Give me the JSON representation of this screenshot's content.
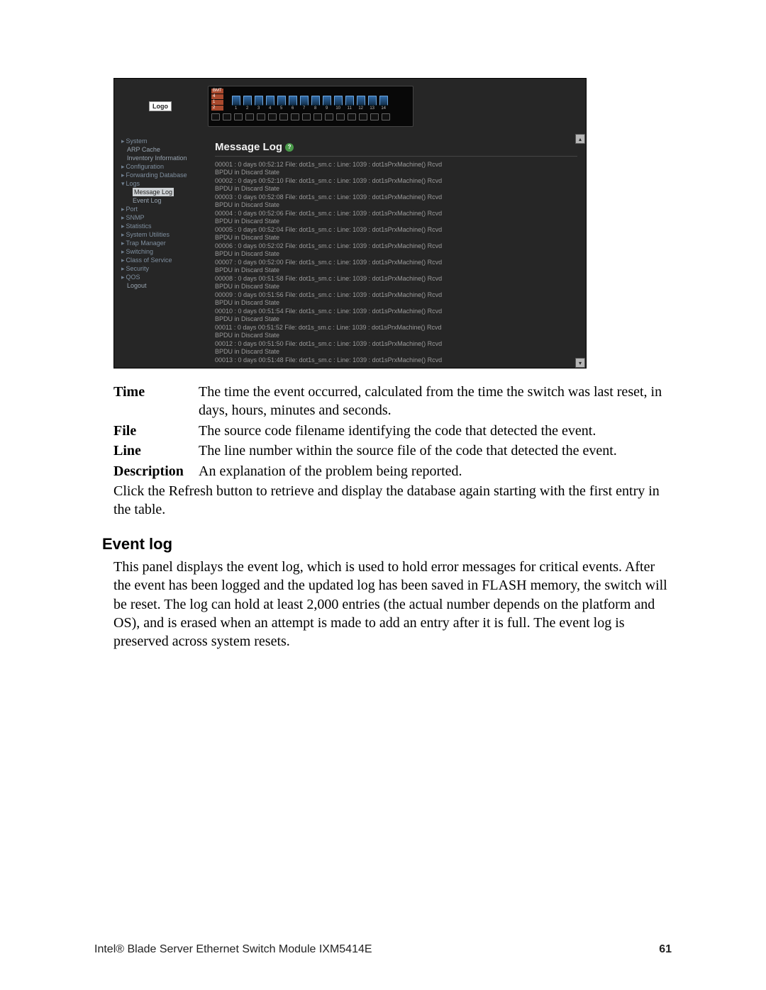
{
  "screenshot": {
    "logo_text": "Logo",
    "device_label_lines": [
      "BMT",
      "4",
      "1",
      "2"
    ],
    "port_numbers": [
      "1",
      "2",
      "3",
      "4",
      "5",
      "6",
      "7",
      "8",
      "9",
      "10",
      "11",
      "12",
      "13",
      "14"
    ],
    "nav": [
      {
        "type": "tri",
        "label": "System"
      },
      {
        "type": "sub",
        "label": "ARP Cache"
      },
      {
        "type": "sub",
        "label": "Inventory Information"
      },
      {
        "type": "tri-sub",
        "label": "Configuration"
      },
      {
        "type": "tri-sub",
        "label": "Forwarding Database"
      },
      {
        "type": "tri-open",
        "label": "Logs"
      },
      {
        "type": "sub2-selected",
        "label": "Message Log"
      },
      {
        "type": "sub2",
        "label": "Event Log"
      },
      {
        "type": "tri-sub",
        "label": "Port"
      },
      {
        "type": "tri-sub",
        "label": "SNMP"
      },
      {
        "type": "tri-sub",
        "label": "Statistics"
      },
      {
        "type": "tri-sub",
        "label": "System Utilities"
      },
      {
        "type": "tri-sub",
        "label": "Trap Manager"
      },
      {
        "type": "tri",
        "label": "Switching"
      },
      {
        "type": "tri",
        "label": "Class of Service"
      },
      {
        "type": "tri",
        "label": "Security"
      },
      {
        "type": "tri",
        "label": "QOS"
      },
      {
        "type": "sub",
        "label": "Logout"
      }
    ],
    "main_title": "Message Log",
    "help_symbol": "?",
    "log_entries": [
      {
        "l1": "00001 : 0 days 00:52:12 File: dot1s_sm.c : Line: 1039 : dot1sPrxMachine() Rcvd",
        "l2": "BPDU in Discard State"
      },
      {
        "l1": "00002 : 0 days 00:52:10 File: dot1s_sm.c : Line: 1039 : dot1sPrxMachine() Rcvd",
        "l2": "BPDU in Discard State"
      },
      {
        "l1": "00003 : 0 days 00:52:08 File: dot1s_sm.c : Line: 1039 : dot1sPrxMachine() Rcvd",
        "l2": "BPDU in Discard State"
      },
      {
        "l1": "00004 : 0 days 00:52:06 File: dot1s_sm.c : Line: 1039 : dot1sPrxMachine() Rcvd",
        "l2": "BPDU in Discard State"
      },
      {
        "l1": "00005 : 0 days 00:52:04 File: dot1s_sm.c : Line: 1039 : dot1sPrxMachine() Rcvd",
        "l2": "BPDU in Discard State"
      },
      {
        "l1": "00006 : 0 days 00:52:02 File: dot1s_sm.c : Line: 1039 : dot1sPrxMachine() Rcvd",
        "l2": "BPDU in Discard State"
      },
      {
        "l1": "00007 : 0 days 00:52:00 File: dot1s_sm.c : Line: 1039 : dot1sPrxMachine() Rcvd",
        "l2": "BPDU in Discard State"
      },
      {
        "l1": "00008 : 0 days 00:51:58 File: dot1s_sm.c : Line: 1039 : dot1sPrxMachine() Rcvd",
        "l2": "BPDU in Discard State"
      },
      {
        "l1": "00009 : 0 days 00:51:56 File: dot1s_sm.c : Line: 1039 : dot1sPrxMachine() Rcvd",
        "l2": "BPDU in Discard State"
      },
      {
        "l1": "00010 : 0 days 00:51:54 File: dot1s_sm.c : Line: 1039 : dot1sPrxMachine() Rcvd",
        "l2": "BPDU in Discard State"
      },
      {
        "l1": "00011 : 0 days 00:51:52 File: dot1s_sm.c : Line: 1039 : dot1sPrxMachine() Rcvd",
        "l2": "BPDU in Discard State"
      },
      {
        "l1": "00012 : 0 days 00:51:50 File: dot1s_sm.c : Line: 1039 : dot1sPrxMachine() Rcvd",
        "l2": "BPDU in Discard State"
      },
      {
        "l1": "00013 : 0 days 00:51:48 File: dot1s_sm.c : Line: 1039 : dot1sPrxMachine() Rcvd",
        "l2": ""
      }
    ],
    "scroll_up": "▴",
    "scroll_down": "▾"
  },
  "definitions": [
    {
      "term": "Time",
      "desc": "The time the event occurred, calculated from the time the switch was last reset, in days, hours, minutes and seconds."
    },
    {
      "term": "File",
      "desc": "The source code filename identifying the code that detected the event."
    },
    {
      "term": "Line",
      "desc": "The line number within the source file of the code that detected the event."
    },
    {
      "term": "Description",
      "desc": "An explanation of the problem being reported."
    }
  ],
  "refresh_para": "Click the Refresh button to retrieve and display the database again starting with the first entry in the table.",
  "event_log": {
    "heading": "Event log",
    "body": "This panel displays the event log, which is used to hold error messages for critical events. After the event has been logged and the updated log has been saved in FLASH memory, the switch will be reset. The log can hold at least 2,000 entries (the actual number depends on the platform and OS), and is erased when an attempt is made to add an entry after it is full. The event log is preserved across system resets."
  },
  "footer": {
    "left": "Intel® Blade Server Ethernet Switch Module IXM5414E",
    "page": "61"
  }
}
